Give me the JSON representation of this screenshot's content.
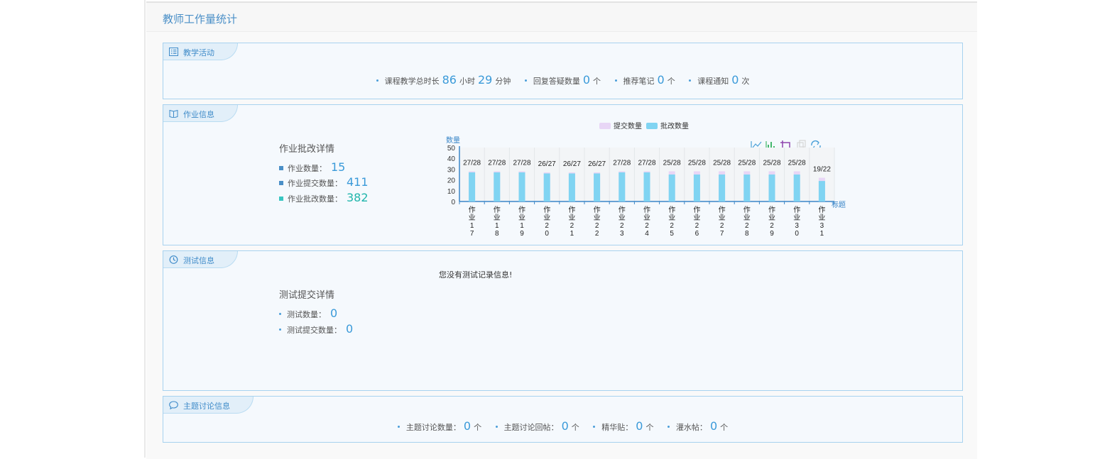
{
  "page": {
    "title": "教师工作量统计"
  },
  "teaching": {
    "tab_label": "教学活动",
    "items": [
      {
        "label": "课程教学总时长",
        "value1": "86",
        "unit1": "小时",
        "value2": "29",
        "unit2": "分钟"
      },
      {
        "label": "回复答疑数量",
        "value": "0",
        "unit": "个"
      },
      {
        "label": "推荐笔记",
        "value": "0",
        "unit": "个"
      },
      {
        "label": "课程通知",
        "value": "0",
        "unit": "次"
      }
    ]
  },
  "homework": {
    "tab_label": "作业信息",
    "detail_title": "作业批改详情",
    "items": [
      {
        "label": "作业数量：",
        "value": "15"
      },
      {
        "label": "作业提交数量：",
        "value": "411"
      },
      {
        "label": "作业批改数量：",
        "value": "382"
      }
    ]
  },
  "chart_data": {
    "type": "bar",
    "title": "",
    "legend": [
      "提交数量",
      "批改数量"
    ],
    "legend_position": "top",
    "ylabel": "数量",
    "xlabel": "标题",
    "yticks": [
      "0",
      "10",
      "20",
      "30",
      "40",
      "50"
    ],
    "ylim": [
      0,
      50
    ],
    "categories": [
      [
        "作",
        "业",
        "1",
        "7"
      ],
      [
        "作",
        "业",
        "1",
        "8"
      ],
      [
        "作",
        "业",
        "1",
        "9"
      ],
      [
        "作",
        "业",
        "2",
        "0"
      ],
      [
        "作",
        "业",
        "2",
        "1"
      ],
      [
        "作",
        "业",
        "2",
        "2"
      ],
      [
        "作",
        "业",
        "2",
        "3"
      ],
      [
        "作",
        "业",
        "2",
        "4"
      ],
      [
        "作",
        "业",
        "2",
        "5"
      ],
      [
        "作",
        "业",
        "2",
        "6"
      ],
      [
        "作",
        "业",
        "2",
        "7"
      ],
      [
        "作",
        "业",
        "2",
        "8"
      ],
      [
        "作",
        "业",
        "2",
        "9"
      ],
      [
        "作",
        "业",
        "3",
        "0"
      ],
      [
        "作",
        "业",
        "3",
        "1"
      ]
    ],
    "series": [
      {
        "name": "提交数量",
        "values": [
          28,
          28,
          28,
          27,
          27,
          27,
          28,
          28,
          28,
          28,
          28,
          28,
          28,
          28,
          22
        ]
      },
      {
        "name": "批改数量",
        "values": [
          27,
          27,
          27,
          26,
          26,
          26,
          27,
          27,
          25,
          25,
          25,
          25,
          25,
          25,
          19
        ]
      }
    ],
    "data_labels": [
      "27/28",
      "27/28",
      "27/28",
      "26/27",
      "26/27",
      "26/27",
      "27/28",
      "27/28",
      "25/28",
      "25/28",
      "25/28",
      "25/28",
      "25/28",
      "25/28",
      "19/22"
    ],
    "colors": {
      "submitted": "#e8d6f6",
      "graded": "#80d4f2",
      "axis": "#3a86c8"
    },
    "toolbox_icons": [
      "line-chart-icon",
      "bar-chart-icon",
      "stack-icon",
      "tiled-icon",
      "refresh-icon"
    ]
  },
  "test": {
    "tab_label": "测试信息",
    "no_record": "您没有测试记录信息!",
    "detail_title": "测试提交详情",
    "items": [
      {
        "label": "测试数量：",
        "value": "0"
      },
      {
        "label": "测试提交数量：",
        "value": "0"
      }
    ]
  },
  "discussion": {
    "tab_label": "主题讨论信息",
    "items": [
      {
        "label": "主题讨论数量：",
        "value": "0",
        "unit": "个"
      },
      {
        "label": "主题讨论回帖：",
        "value": "0",
        "unit": "个"
      },
      {
        "label": "精华贴：",
        "value": "0",
        "unit": "个"
      },
      {
        "label": "灌水帖：",
        "value": "0",
        "unit": "个"
      }
    ]
  }
}
